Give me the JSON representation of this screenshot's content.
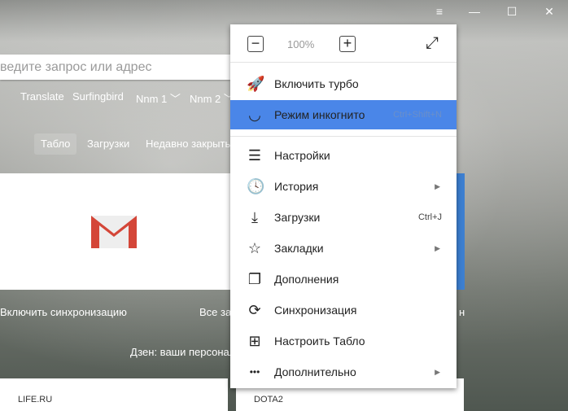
{
  "window": {
    "menu_icon": "≡",
    "minimize": "—",
    "maximize": "☐",
    "close": "✕"
  },
  "search": {
    "placeholder": "ведите запрос или адрес"
  },
  "bookmarks": [
    "Translate",
    "Surfingbird",
    "Nnm 1 ﹀",
    "Nnm 2 ﹀"
  ],
  "tabs": [
    "Табло",
    "Загрузки",
    "Недавно закрыть"
  ],
  "page": {
    "sync": "Включить синхронизацию",
    "all": "Все за",
    "trail": "н",
    "zen": "Дзен: ваши персонал",
    "cards": [
      "LIFE.RU",
      "DOTA2"
    ]
  },
  "menu": {
    "zoom": {
      "minus": "−",
      "value": "100%",
      "plus": "+",
      "fullscreen": "⤢"
    },
    "items": [
      {
        "label": "Включить турбо",
        "icon": "🚀"
      },
      {
        "label": "Режим инкогнито",
        "icon": "◡",
        "shortcut": "Ctrl+Shift+N",
        "highlight": true
      },
      {
        "label": "Настройки",
        "icon": "☰"
      },
      {
        "label": "История",
        "icon": "🕓",
        "arrow": "▶"
      },
      {
        "label": "Загрузки",
        "icon": "⤓",
        "shortcut": "Ctrl+J"
      },
      {
        "label": "Закладки",
        "icon": "☆",
        "arrow": "▶"
      },
      {
        "label": "Дополнения",
        "icon": "❐"
      },
      {
        "label": "Синхронизация",
        "icon": "⟳"
      },
      {
        "label": "Настроить Табло",
        "icon": "⊞"
      },
      {
        "label": "Дополнительно",
        "icon": "•••",
        "arrow": "▶"
      }
    ]
  }
}
